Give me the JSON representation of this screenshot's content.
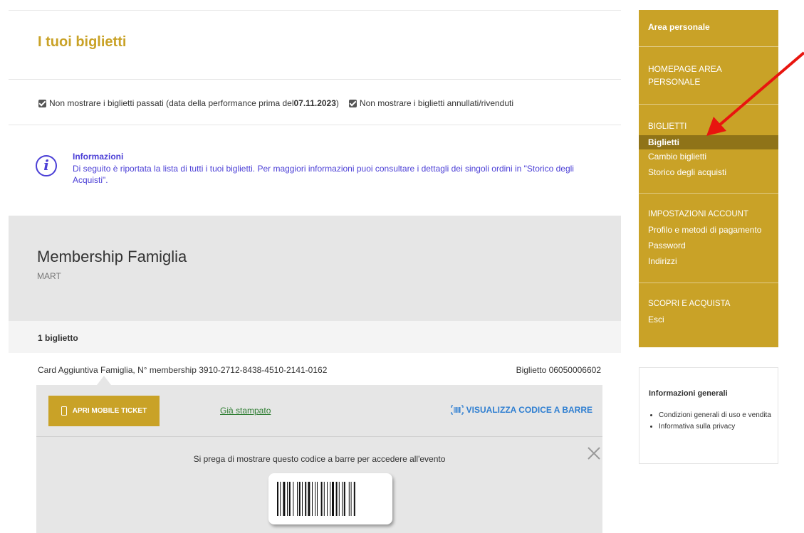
{
  "page": {
    "title": "I tuoi biglietti"
  },
  "filters": {
    "past": {
      "label": "Non mostrare i biglietti passati (data della performance prima del ",
      "date": "07.11.2023",
      "suffix": ")"
    },
    "cancelled": {
      "label": "Non mostrare i biglietti annullati/rivenduti"
    }
  },
  "info": {
    "title": "Informazioni",
    "text": "Di seguito è riportata la lista di tutti i tuoi biglietti. Per maggiori informazioni puoi consultare i dettagli dei singoli ordini in \"Storico degli Acquisti\"."
  },
  "event": {
    "name": "Membership Famiglia",
    "venue": "MART"
  },
  "tickets": {
    "count_label": "1 biglietto",
    "items": [
      {
        "description": "Card Aggiuntiva Famiglia, N° membership 3910-2712-8438-4510-2141-0162",
        "number": "Biglietto 06050006602",
        "mobile_button": "APRI MOBILE TICKET",
        "printed_link": "Già stampato",
        "barcode_link": "VISUALIZZA CODICE A BARRE",
        "barcode_message": "Si prega di mostrare questo codice a barre per accedere all'evento"
      }
    ]
  },
  "sidebar": {
    "header": "Area personale",
    "home_line1": "HOMEPAGE AREA",
    "home_line2": "PERSONALE",
    "tickets_section": "BIGLIETTI",
    "tickets_items": [
      "Biglietti",
      "Cambio biglietti",
      "Storico degli acquisti"
    ],
    "account_section": "IMPOSTAZIONI ACCOUNT",
    "account_items": [
      "Profilo e metodi di pagamento",
      "Password",
      "Indirizzi"
    ],
    "shop_section": "SCOPRI E ACQUISTA",
    "logout": "Esci"
  },
  "general_info": {
    "title": "Informazioni generali",
    "links": [
      "Condizioni generali di uso e vendita",
      "Informativa sulla privacy"
    ]
  },
  "colors": {
    "accent_gold": "#c9a227",
    "active_item": "#8f7318",
    "info_purple": "#4b3fd6",
    "link_green": "#2e7d32",
    "link_blue": "#2f7fd1",
    "arrow_red": "#e8150f"
  },
  "icons": {
    "check": "check-icon",
    "info": "info-icon",
    "phone": "phone-icon",
    "barcode": "barcode-icon",
    "close": "close-icon",
    "arrow": "arrow-annotation"
  }
}
